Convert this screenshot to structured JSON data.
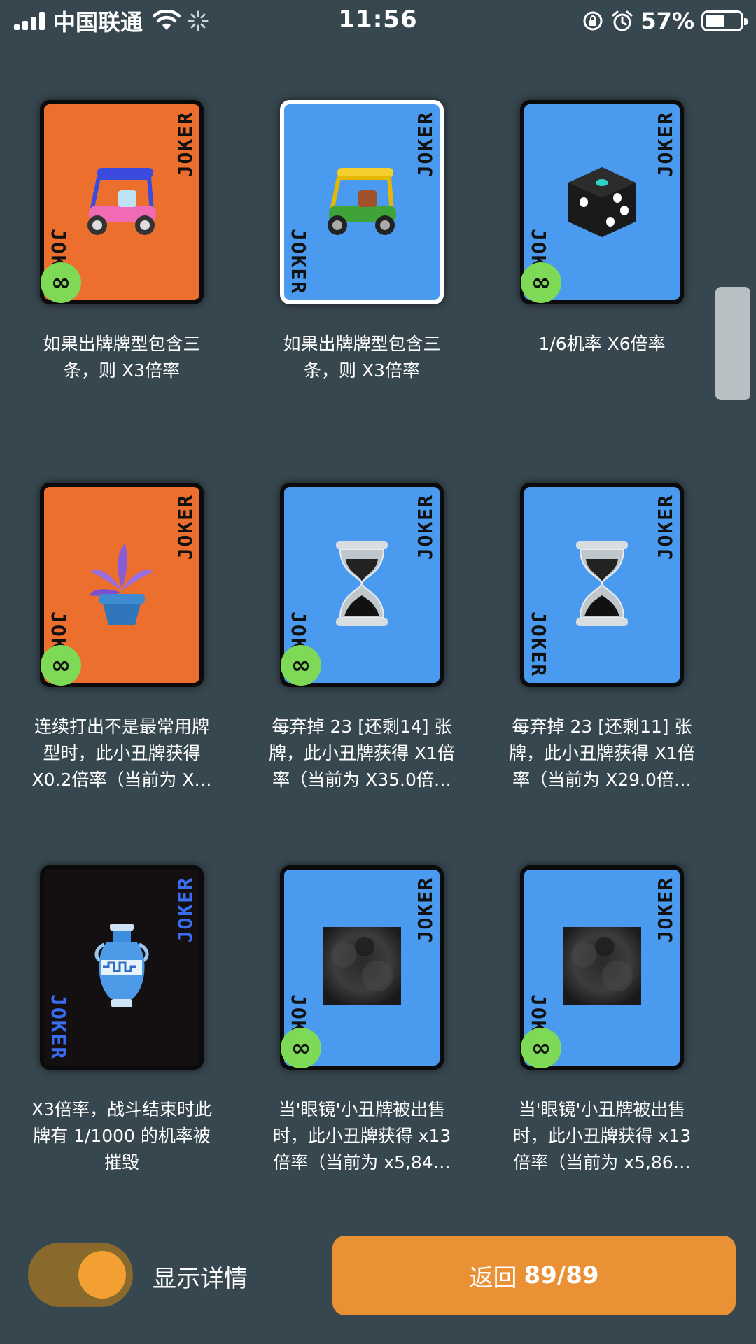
{
  "status_bar": {
    "carrier": "中国联通",
    "time": "11:56",
    "battery_percent": "57%",
    "battery_level": 0.57,
    "icons": [
      "signal-icon",
      "wifi-icon",
      "loading-spinner-icon",
      "rotation-lock-icon",
      "alarm-icon",
      "battery-icon"
    ]
  },
  "cards": [
    {
      "bg": "#ec6f2d",
      "art": "auto-rickshaw-pink",
      "badge": "∞",
      "selected": false,
      "joker_top": "JOKER",
      "joker_bottom": "JOKER",
      "desc_lines": [
        "如果出牌牌型包含三",
        "条，则 X3倍率"
      ]
    },
    {
      "bg": "#4a9bf0",
      "art": "auto-rickshaw",
      "badge": "",
      "selected": true,
      "joker_top": "JOKER",
      "joker_bottom": "JOKER",
      "desc_lines": [
        "如果出牌牌型包含三",
        "条，则 X3倍率"
      ]
    },
    {
      "bg": "#4a9bf0",
      "art": "dice",
      "badge": "∞",
      "selected": false,
      "joker_top": "JOKER",
      "joker_bottom": "JOKER",
      "desc_lines": [
        "1/6机率 X6倍率"
      ]
    },
    {
      "bg": "#ec6f2d",
      "art": "potted-plant",
      "badge": "∞",
      "selected": false,
      "joker_top": "JOKER",
      "joker_bottom": "JOKER",
      "desc_lines": [
        "连续打出不是最常用牌",
        "型时，此小丑牌获得",
        "X0.2倍率（当前为 X…"
      ]
    },
    {
      "bg": "#4a9bf0",
      "art": "hourglass",
      "badge": "∞",
      "selected": false,
      "joker_top": "JOKER",
      "joker_bottom": "JOKER",
      "desc_lines": [
        "每弃掉 23 [还剩14] 张",
        "牌，此小丑牌获得 X1倍",
        "率（当前为 X35.0倍…"
      ]
    },
    {
      "bg": "#4a9bf0",
      "art": "hourglass",
      "badge": "",
      "selected": false,
      "joker_top": "JOKER",
      "joker_bottom": "JOKER",
      "desc_lines": [
        "每弃掉 23 [还剩11] 张",
        "牌，此小丑牌获得 X1倍",
        "率（当前为 X29.0倍…"
      ]
    },
    {
      "bg": "#141012",
      "art": "amphora",
      "badge": "",
      "selected": false,
      "dark": true,
      "joker_top": "JOKER",
      "joker_bottom": "JOKER",
      "desc_lines": [
        "X3倍率，战斗结束时此",
        "牌有 1/1000 的机率被",
        "摧毁"
      ]
    },
    {
      "bg": "#4a9bf0",
      "art": "dark-square",
      "badge": "∞",
      "selected": false,
      "joker_top": "JOKER",
      "joker_bottom": "JOKER",
      "desc_lines": [
        "当'眼镜'小丑牌被出售",
        "时，此小丑牌获得 x13",
        "倍率（当前为 x5,84…"
      ]
    },
    {
      "bg": "#4a9bf0",
      "art": "dark-square",
      "badge": "∞",
      "selected": false,
      "joker_top": "JOKER",
      "joker_bottom": "JOKER",
      "desc_lines": [
        "当'眼镜'小丑牌被出售",
        "时，此小丑牌获得 x13",
        "倍率（当前为 x5,86…"
      ]
    }
  ],
  "toggle": {
    "label": "显示详情",
    "on": true
  },
  "return_button": {
    "label": "返回",
    "count": "89/89"
  }
}
